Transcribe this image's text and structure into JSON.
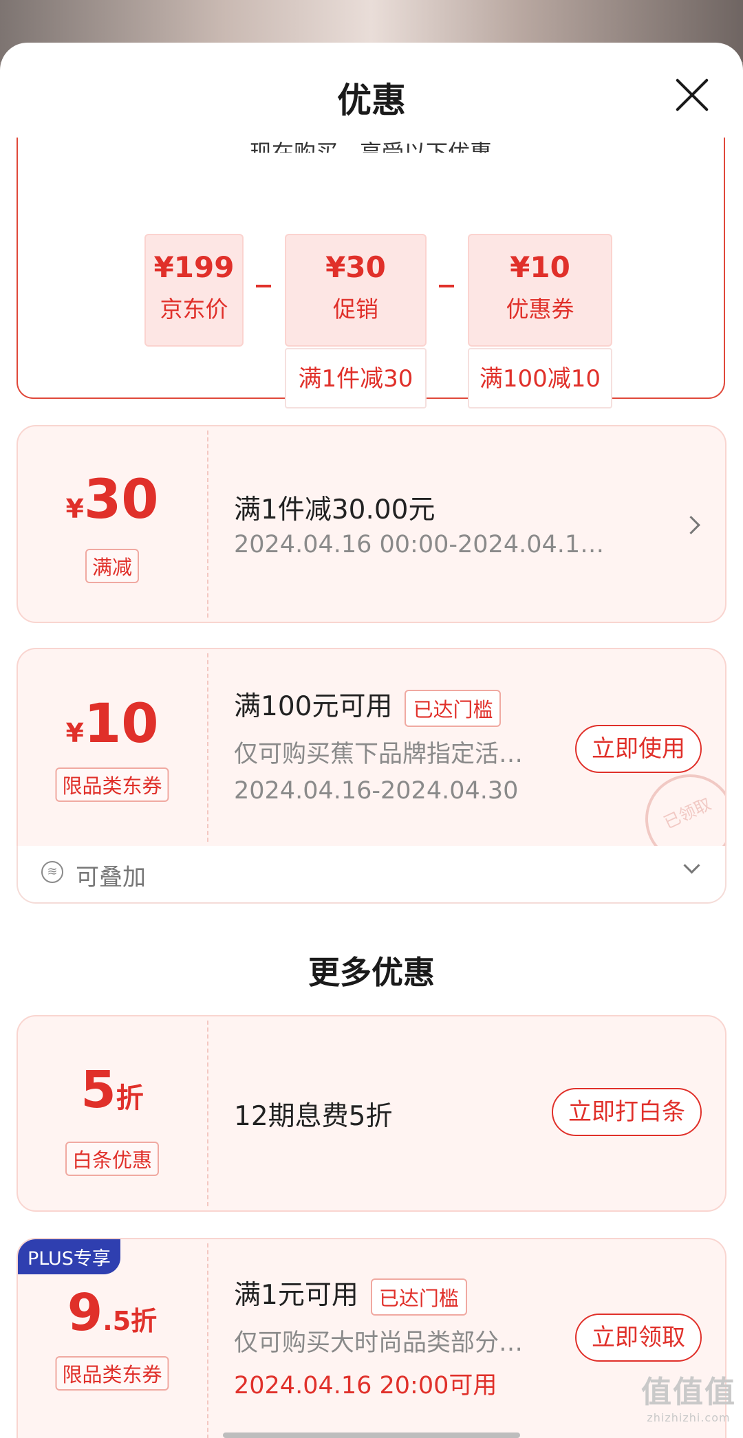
{
  "sheet": {
    "title": "优惠"
  },
  "summary": {
    "heading": "现在购买，享受以下优惠",
    "jd_price": {
      "amount": "¥199",
      "label": "京东价"
    },
    "promotion": {
      "amount": "¥30",
      "label": "促销",
      "detail": "满1件减30"
    },
    "coupon": {
      "amount": "¥10",
      "label": "优惠券",
      "detail": "满100减10"
    }
  },
  "cards": [
    {
      "currency": "¥",
      "value": "30",
      "tag": "满减",
      "title": "满1件减30.00元",
      "subtitle": "2024.04.16 00:00-2024.04.1…"
    },
    {
      "currency": "¥",
      "value": "10",
      "tag": "限品类东券",
      "title": "满100元可用",
      "badge": "已达门槛",
      "subtitle": "仅可购买蕉下品牌指定活…",
      "date": "2024.04.16-2024.04.30",
      "button": "立即使用",
      "stamp": "已领取",
      "stacking_label": "可叠加"
    }
  ],
  "more_section": {
    "title": "更多优惠"
  },
  "more_cards": [
    {
      "value": "5",
      "unit": "折",
      "tag": "白条优惠",
      "title": "12期息费5折",
      "button": "立即打白条"
    },
    {
      "plus_badge": "PLUS专享",
      "value_int": "9",
      "value_dec": ".5折",
      "tag": "限品类东券",
      "title": "满1元可用",
      "badge": "已达门槛",
      "subtitle": "仅可购买大时尚品类部分…",
      "date": "2024.04.16 20:00可用",
      "button": "立即领取"
    }
  ],
  "watermark": {
    "main": "值值值",
    "sub": "zhizhizhi.com"
  },
  "colors": {
    "accent": "#e0302a",
    "card_bg": "#fff4f2",
    "plus_blue": "#2f3fb0"
  }
}
